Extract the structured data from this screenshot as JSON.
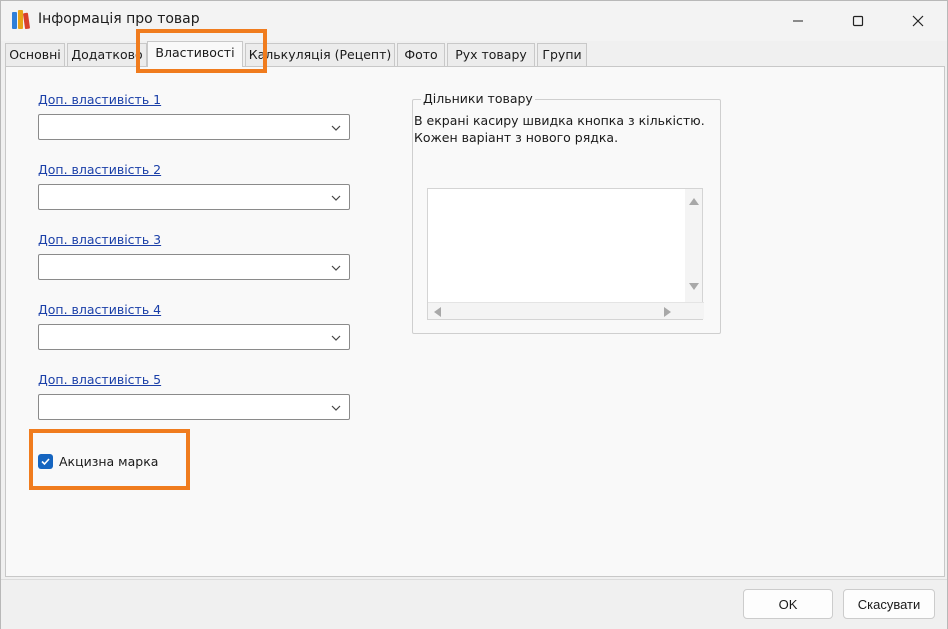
{
  "window": {
    "title": "Інформація про товар",
    "app_icon": "books-icon",
    "controls": {
      "minimize": "minimize-icon",
      "maximize": "maximize-icon",
      "close": "close-icon"
    }
  },
  "tabs": [
    {
      "label": "Основні"
    },
    {
      "label": "Додатково"
    },
    {
      "label": "Властивості",
      "active": true
    },
    {
      "label": "Калькуляція (Рецепт)"
    },
    {
      "label": "Фото"
    },
    {
      "label": "Рух товару"
    },
    {
      "label": "Групи"
    }
  ],
  "properties": [
    {
      "label": "Доп. властивість 1",
      "value": ""
    },
    {
      "label": "Доп. властивість 2",
      "value": ""
    },
    {
      "label": "Доп. властивість 3",
      "value": ""
    },
    {
      "label": "Доп. властивість 4",
      "value": ""
    },
    {
      "label": "Доп. властивість 5",
      "value": ""
    }
  ],
  "excise": {
    "label": "Акцизна марка",
    "checked": true
  },
  "sections": {
    "title": "Дільники товару",
    "description_line1": "В екрані касиру швидка кнопка з кількістю.",
    "description_line2": "Кожен варіант з нового рядка.",
    "value": ""
  },
  "buttons": {
    "ok": "OK",
    "cancel": "Скасувати"
  },
  "colors": {
    "accent": "#1565c0",
    "link": "#1a3fa8",
    "highlight": "#f07c1e"
  }
}
